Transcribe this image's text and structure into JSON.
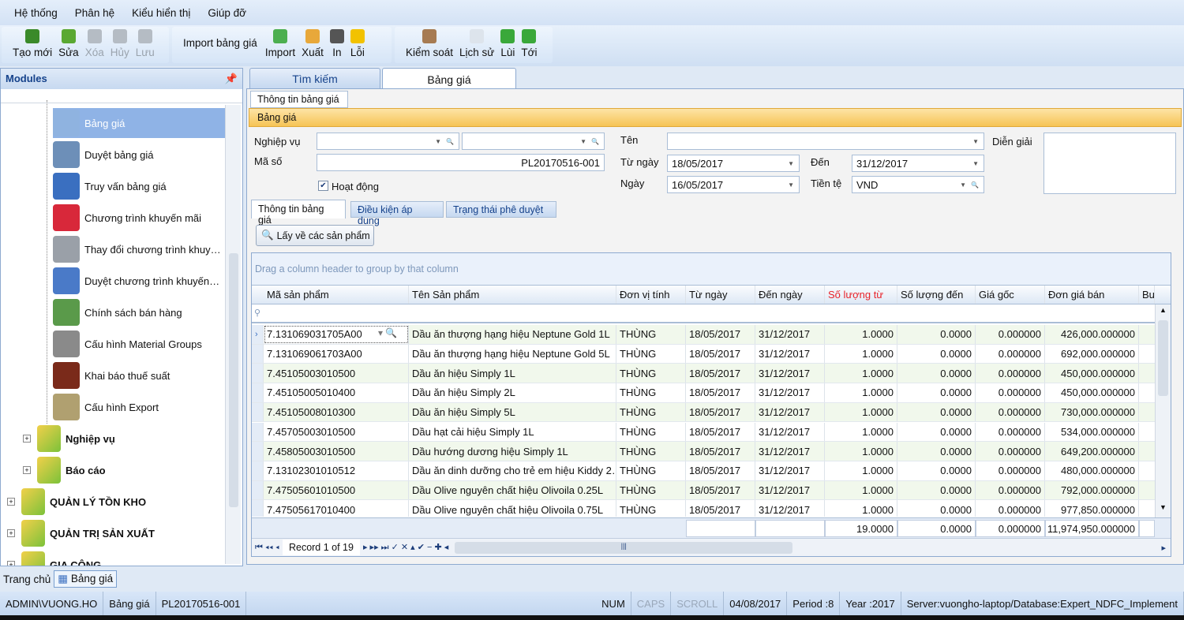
{
  "menu": [
    "Hệ thống",
    "Phân hệ",
    "Kiểu hiển thị",
    "Giúp đỡ"
  ],
  "toolbar": {
    "g1": [
      {
        "label": "Tạo mới",
        "icon": "new-icon",
        "enabled": true,
        "color": "#3a8a2a"
      },
      {
        "label": "Sửa",
        "icon": "pencil-icon",
        "enabled": true,
        "color": "#5aa832"
      },
      {
        "label": "Xóa",
        "icon": "delete-icon",
        "enabled": false,
        "color": "#b5bcc4"
      },
      {
        "label": "Hủy",
        "icon": "cancel-icon",
        "enabled": false,
        "color": "#b5bcc4"
      },
      {
        "label": "Lưu",
        "icon": "save-icon",
        "enabled": false,
        "color": "#b5bcc4"
      }
    ],
    "import_label": "Import bảng giá",
    "g2": [
      {
        "label": "Import",
        "icon": "import-icon",
        "enabled": true,
        "color": "#4caf50"
      },
      {
        "label": "Xuất",
        "icon": "export-icon",
        "enabled": true,
        "color": "#e8a83a"
      },
      {
        "label": "In",
        "icon": "printer-icon",
        "enabled": true,
        "color": "#555"
      },
      {
        "label": "Lỗi",
        "icon": "warning-icon",
        "enabled": true,
        "color": "#f2c200"
      }
    ],
    "g3": [
      {
        "label": "Kiểm soát",
        "icon": "user-icon",
        "enabled": true,
        "color": "#a67b52"
      },
      {
        "label": "Lịch sử",
        "icon": "history-icon",
        "enabled": true,
        "color": "#dde4ec"
      },
      {
        "label": "Lùi",
        "icon": "back-icon",
        "enabled": true,
        "color": "#3aa83a"
      },
      {
        "label": "Tới",
        "icon": "forward-icon",
        "enabled": true,
        "color": "#3aa83a"
      }
    ]
  },
  "sidebar": {
    "title": "Modules",
    "items": [
      {
        "label": "Bảng giá",
        "selected": true
      },
      {
        "label": "Duyệt bảng giá"
      },
      {
        "label": "Truy vấn bảng giá"
      },
      {
        "label": "Chương trình khuyến mãi"
      },
      {
        "label": "Thay đổi chương trình khuy…"
      },
      {
        "label": "Duyệt chương trình khuyến…"
      },
      {
        "label": "Chính sách bán hàng"
      },
      {
        "label": "Cấu hình Material Groups"
      },
      {
        "label": "Khai báo thuế suất"
      },
      {
        "label": "Cấu hình Export"
      }
    ],
    "folders": [
      {
        "label": "Nghiệp vụ",
        "level": 2
      },
      {
        "label": "Báo cáo",
        "level": 2
      },
      {
        "label": "QUẢN LÝ TỒN KHO",
        "level": 1
      },
      {
        "label": "QUẢN TRỊ SẢN XUẤT",
        "level": 1
      },
      {
        "label": "GIA CÔNG",
        "level": 1
      }
    ]
  },
  "tabs": [
    "Tìm kiếm",
    "Bảng giá"
  ],
  "subtab": "Thông tin bảng giá",
  "section_title": "Bảng giá",
  "form": {
    "nghiep_vu_label": "Nghiệp vụ",
    "ma_so_label": "Mã số",
    "ma_so": "PL20170516-001",
    "hoat_dong_label": "Hoạt động",
    "hoat_dong": true,
    "ten_label": "Tên",
    "tu_ngay_label": "Từ ngày",
    "tu_ngay": "18/05/2017",
    "den_label": "Đến",
    "den": "31/12/2017",
    "ngay_label": "Ngày",
    "ngay": "16/05/2017",
    "tien_te_label": "Tiền tệ",
    "tien_te": "VND",
    "dien_giai_label": "Diễn giải"
  },
  "inner_tabs": [
    "Thông tin bảng giá",
    "Điều kiện áp dụng",
    "Trạng thái phê duyệt"
  ],
  "fetch_button": "Lấy về các sản phẩm",
  "group_hint": "Drag a column header to group by that column",
  "grid": {
    "columns": [
      "Mã sản phẩm",
      "Tên Sản phẩm",
      "Đơn vị tính",
      "Từ ngày",
      "Đến ngày",
      "Số lượng từ",
      "Số lượng đến",
      "Giá gốc",
      "Đơn giá bán",
      "Busine"
    ],
    "highlight_column_color": "#e8232a",
    "rows": [
      [
        "7.131069031705A00",
        "Dầu ăn thượng hạng hiệu Neptune Gold 1L",
        "THÙNG",
        "18/05/2017",
        "31/12/2017",
        "1.0000",
        "0.0000",
        "0.000000",
        "426,000.000000"
      ],
      [
        "7.131069061703A00",
        "Dầu ăn thượng hạng hiệu Neptune Gold 5L",
        "THÙNG",
        "18/05/2017",
        "31/12/2017",
        "1.0000",
        "0.0000",
        "0.000000",
        "692,000.000000"
      ],
      [
        "7.45105003010500",
        "Dầu ăn hiệu  Simply 1L",
        "THÙNG",
        "18/05/2017",
        "31/12/2017",
        "1.0000",
        "0.0000",
        "0.000000",
        "450,000.000000"
      ],
      [
        "7.45105005010400",
        "Dầu ăn hiệu  Simply 2L",
        "THÙNG",
        "18/05/2017",
        "31/12/2017",
        "1.0000",
        "0.0000",
        "0.000000",
        "450,000.000000"
      ],
      [
        "7.45105008010300",
        "Dầu ăn hiệu  Simply 5L",
        "THÙNG",
        "18/05/2017",
        "31/12/2017",
        "1.0000",
        "0.0000",
        "0.000000",
        "730,000.000000"
      ],
      [
        "7.45705003010500",
        "Dầu hạt cải hiệu Simply 1L",
        "THÙNG",
        "18/05/2017",
        "31/12/2017",
        "1.0000",
        "0.0000",
        "0.000000",
        "534,000.000000"
      ],
      [
        "7.45805003010500",
        "Dầu hướng dương hiệu Simply 1L",
        "THÙNG",
        "18/05/2017",
        "31/12/2017",
        "1.0000",
        "0.0000",
        "0.000000",
        "649,200.000000"
      ],
      [
        "7.13102301010512",
        "Dầu ăn dinh dưỡng cho trẻ em hiệu Kiddy 2…",
        "THÙNG",
        "18/05/2017",
        "31/12/2017",
        "1.0000",
        "0.0000",
        "0.000000",
        "480,000.000000"
      ],
      [
        "7.47505601010500",
        "Dầu Olive nguyên chất hiệu  Olivoila 0.25L",
        "THÙNG",
        "18/05/2017",
        "31/12/2017",
        "1.0000",
        "0.0000",
        "0.000000",
        "792,000.000000"
      ],
      [
        "7.47505617010400",
        "Dầu Olive nguyên chất hiệu  Olivoila 0.75L",
        "THÙNG",
        "18/05/2017",
        "31/12/2017",
        "1.0000",
        "0.0000",
        "0.000000",
        "977,850.000000"
      ]
    ],
    "totals": {
      "so_luong_tu": "19.0000",
      "so_luong_den": "0.0000",
      "gia_goc": "0.000000",
      "don_gia_ban": "11,974,950.000000"
    },
    "record_text": "Record 1 of 19"
  },
  "bottom_tabs": [
    "Trang chủ",
    "Bảng giá"
  ],
  "status": [
    "ADMIN\\VUONG.HO",
    "Bảng giá",
    "PL20170516-001"
  ],
  "status_right": [
    {
      "t": "NUM",
      "on": true
    },
    {
      "t": "CAPS",
      "on": false
    },
    {
      "t": "SCROLL",
      "on": false
    },
    {
      "t": "04/08/2017",
      "on": true
    },
    {
      "t": "Period :8",
      "on": true
    },
    {
      "t": "Year :2017",
      "on": true
    },
    {
      "t": "Server:vuongho-laptop/Database:Expert_NDFC_Implement",
      "on": true
    }
  ]
}
